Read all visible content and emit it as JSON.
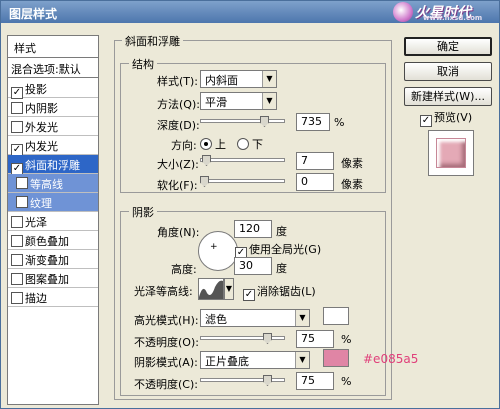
{
  "window": {
    "title": "图层样式"
  },
  "watermark": {
    "text": "火星时代",
    "url": "www.hxsd.com"
  },
  "styles": {
    "header": "样式",
    "blend_options": "混合选项:默认",
    "items": [
      {
        "label": "投影",
        "checked": true
      },
      {
        "label": "内阴影",
        "checked": false
      },
      {
        "label": "外发光",
        "checked": false
      },
      {
        "label": "内发光",
        "checked": true
      },
      {
        "label": "斜面和浮雕",
        "checked": true,
        "selected": true
      },
      {
        "label": "等高线",
        "checked": false,
        "sub": true
      },
      {
        "label": "纹理",
        "checked": false,
        "sub": true
      },
      {
        "label": "光泽",
        "checked": false
      },
      {
        "label": "颜色叠加",
        "checked": false
      },
      {
        "label": "渐变叠加",
        "checked": false
      },
      {
        "label": "图案叠加",
        "checked": false
      },
      {
        "label": "描边",
        "checked": false
      }
    ]
  },
  "bevel": {
    "title": "斜面和浮雕",
    "structure_title": "结构",
    "style_label": "样式(T):",
    "style_value": "内斜面",
    "method_label": "方法(Q):",
    "method_value": "平滑",
    "depth_label": "深度(D):",
    "depth_value": "735",
    "depth_unit": "%",
    "direction_label": "方向:",
    "dir_up": "上",
    "dir_down": "下",
    "size_label": "大小(Z):",
    "size_value": "7",
    "size_unit": "像素",
    "soften_label": "软化(F):",
    "soften_value": "0",
    "soften_unit": "像素"
  },
  "shading": {
    "title": "阴影",
    "angle_label": "角度(N):",
    "angle_value": "120",
    "angle_unit": "度",
    "global_light": "使用全局光(G)",
    "altitude_label": "高度:",
    "altitude_value": "30",
    "altitude_unit": "度",
    "gloss_label": "光泽等高线:",
    "anti_alias": "消除锯齿(L)",
    "highlight_mode_label": "高光模式(H):",
    "highlight_mode_value": "滤色",
    "highlight_color": "#ffffff",
    "opacity1_label": "不透明度(O):",
    "opacity1_value": "75",
    "opacity_unit": "%",
    "shadow_mode_label": "阴影模式(A):",
    "shadow_mode_value": "正片叠底",
    "shadow_color": "#e085a5",
    "opacity2_label": "不透明度(C):",
    "opacity2_value": "75",
    "annotation": "#e085a5"
  },
  "buttons": {
    "ok": "确定",
    "cancel": "取消",
    "new_style": "新建样式(W)...",
    "preview": "预览(V)"
  }
}
